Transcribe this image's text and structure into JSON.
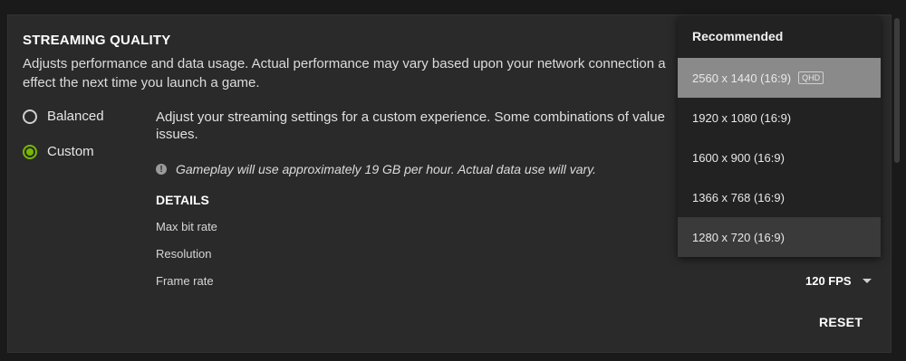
{
  "section": {
    "title": "STREAMING QUALITY",
    "description_line1": "Adjusts performance and data usage. Actual performance may vary based upon your network connection a",
    "description_line2": "effect the next time you launch a game."
  },
  "options": [
    {
      "label": "Balanced",
      "checked": false
    },
    {
      "label": "Custom",
      "checked": true
    }
  ],
  "custom": {
    "description_line1": "Adjust your streaming settings for a custom experience. Some combinations of value",
    "description_line2": "issues.",
    "notice": "Gameplay will use approximately 19 GB per hour. Actual data use will vary.",
    "notice_icon": "info-icon"
  },
  "details": {
    "heading": "DETAILS",
    "rows": [
      {
        "label": "Max bit rate"
      },
      {
        "label": "Resolution"
      },
      {
        "label": "Frame rate",
        "value": "120 FPS"
      }
    ]
  },
  "reset_label": "RESET",
  "dropdown": {
    "header": "Recommended",
    "items": [
      {
        "label": "2560 x 1440 (16:9)",
        "badge": "QHD",
        "state": "selected"
      },
      {
        "label": "1920 x 1080 (16:9)",
        "state": "normal"
      },
      {
        "label": "1600 x 900 (16:9)",
        "state": "normal"
      },
      {
        "label": "1366 x 768 (16:9)",
        "state": "normal"
      },
      {
        "label": "1280 x 720 (16:9)",
        "state": "hover"
      }
    ]
  },
  "colors": {
    "accent": "#76b900",
    "panel": "#2a2a2a",
    "selected_item": "#8a8a8a"
  }
}
